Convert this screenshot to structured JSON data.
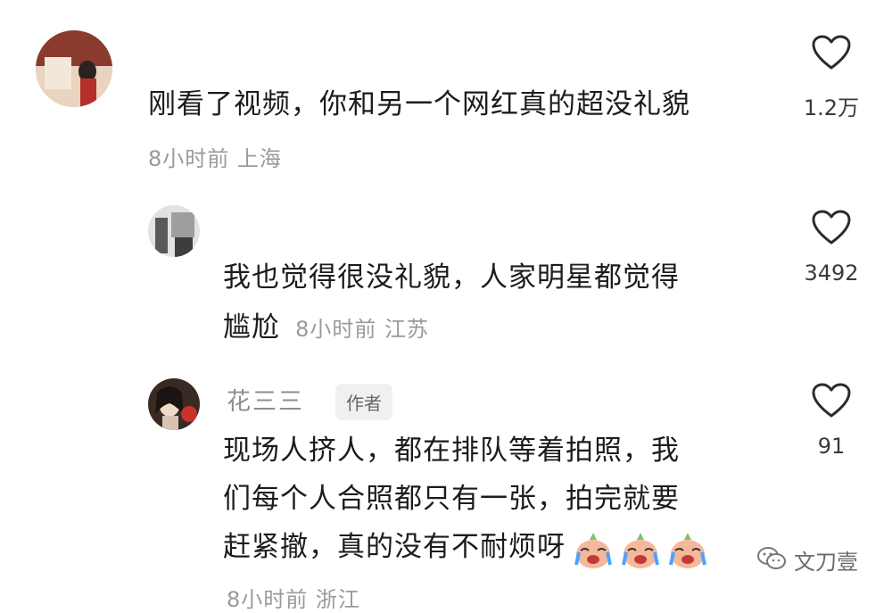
{
  "comments": [
    {
      "text": "刚看了视频，你和另一个网红真的超没礼貌",
      "meta": "8小时前 上海",
      "likes": "1.2万"
    },
    {
      "text_line1": "我也觉得很没礼貌，人家明星都觉得",
      "text_line2": "尴尬",
      "meta": "8小时前 江苏",
      "likes": "3492"
    },
    {
      "username": "花三三",
      "badge": "作者",
      "text_line1": "现场人挤人，都在排队等着拍照，我",
      "text_line2": "们每个人合照都只有一张，拍完就要",
      "text_line3": "赶紧撤，真的没有不耐烦呀",
      "emoji": [
        "crying-laughing-face",
        "crying-laughing-face",
        "crying-laughing-face"
      ],
      "meta_partial": "8小时前 浙江",
      "likes": "91"
    }
  ],
  "watermark": {
    "icon": "wechat-icon",
    "text": "文刀壹"
  }
}
